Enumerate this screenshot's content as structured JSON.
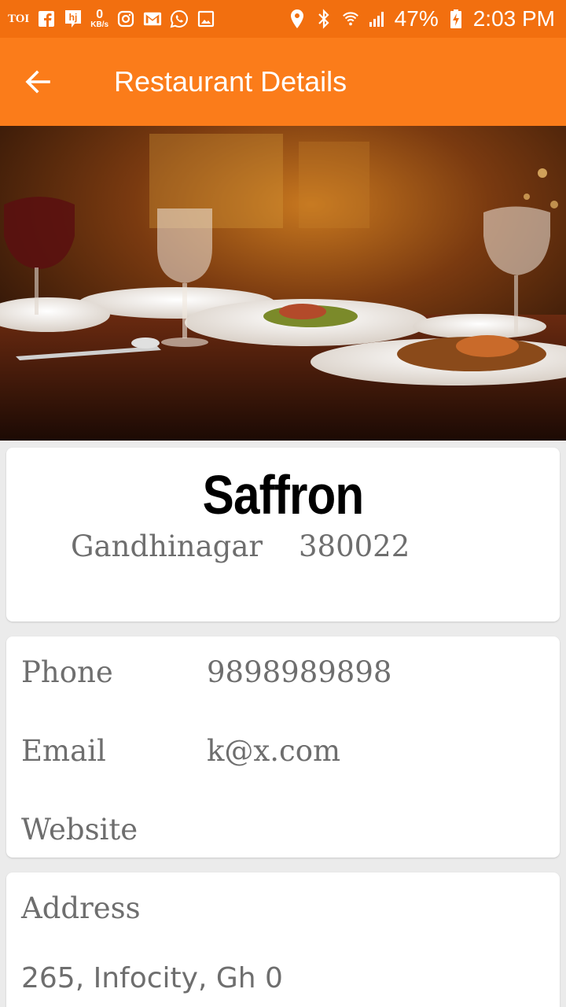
{
  "status_bar": {
    "toi_label": "TOI",
    "hj_label": "hj",
    "net_speed": "0",
    "net_unit": "KB/s",
    "battery": "47%",
    "time": "2:03 PM"
  },
  "app_bar": {
    "title": "Restaurant Details"
  },
  "hero": {
    "image": "restaurant-table-photo"
  },
  "restaurant": {
    "name": "Saffron",
    "city": "Gandhinagar",
    "pincode": "380022"
  },
  "contact": {
    "phone_label": "Phone",
    "phone_value": "9898989898",
    "email_label": "Email",
    "email_value": "k@x.com",
    "website_label": "Website",
    "website_value": ""
  },
  "address": {
    "label": "Address",
    "value": "265, Infocity, Gh 0"
  },
  "colors": {
    "status_bar": "#f26f0f",
    "app_bar": "#fb7c1a",
    "text_secondary": "#6e6e6e"
  }
}
